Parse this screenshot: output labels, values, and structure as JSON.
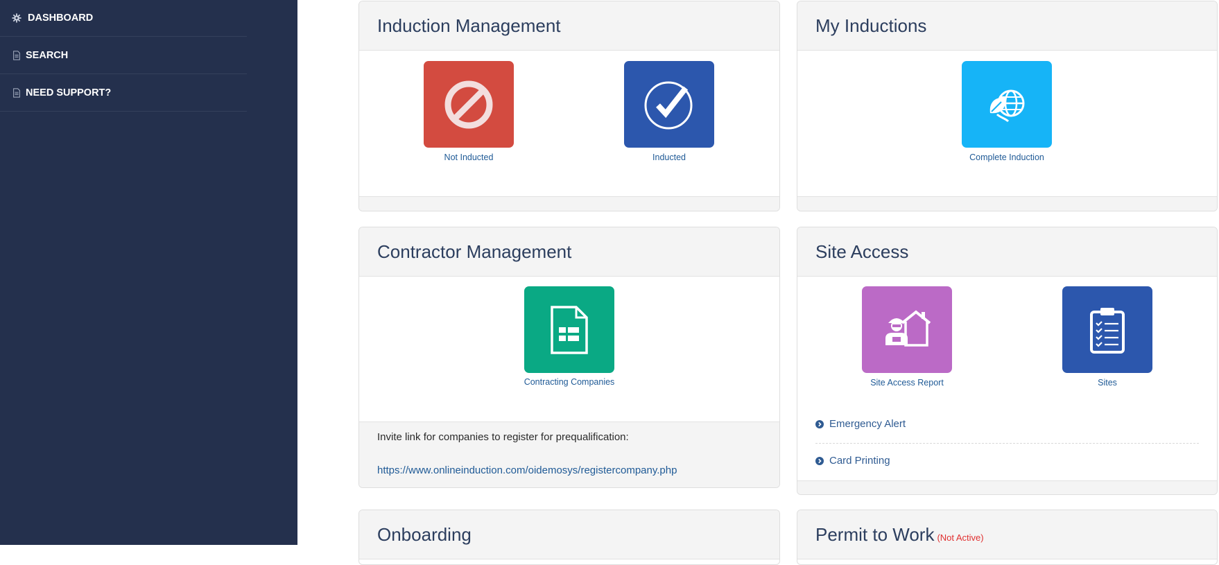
{
  "sidebar": {
    "items": [
      {
        "label": "DASHBOARD",
        "icon": "gear-icon"
      },
      {
        "label": "SEARCH",
        "icon": "document-icon"
      },
      {
        "label": "NEED SUPPORT?",
        "icon": "document-icon"
      }
    ]
  },
  "panels": {
    "induction_management": {
      "title": "Induction Management",
      "tiles": [
        {
          "label": "Not Inducted",
          "color": "#d34b40",
          "icon": "prohibited-icon"
        },
        {
          "label": "Inducted",
          "color": "#2c57ad",
          "icon": "check-circle-icon"
        }
      ]
    },
    "my_inductions": {
      "title": "My Inductions",
      "tiles": [
        {
          "label": "Complete Induction",
          "color": "#16b4f7",
          "icon": "globe-leaf-icon"
        }
      ]
    },
    "contractor_management": {
      "title": "Contractor Management",
      "tiles": [
        {
          "label": "Contracting Companies",
          "color": "#0aa984",
          "icon": "form-document-icon"
        }
      ],
      "invite_text": "Invite link for companies to register for prequalification:",
      "invite_link": "https://www.onlineinduction.com/oidemosys/registercompany.php"
    },
    "site_access": {
      "title": "Site Access",
      "tiles": [
        {
          "label": "Site Access Report",
          "color": "#bb6ac6",
          "icon": "worker-house-icon"
        },
        {
          "label": "Sites",
          "color": "#2c57ad",
          "icon": "clipboard-checklist-icon"
        }
      ],
      "links": [
        {
          "label": "Emergency Alert"
        },
        {
          "label": "Card Printing"
        }
      ]
    },
    "onboarding": {
      "title": "Onboarding"
    },
    "permit_to_work": {
      "title": "Permit to Work",
      "status": "(Not Active)"
    }
  }
}
